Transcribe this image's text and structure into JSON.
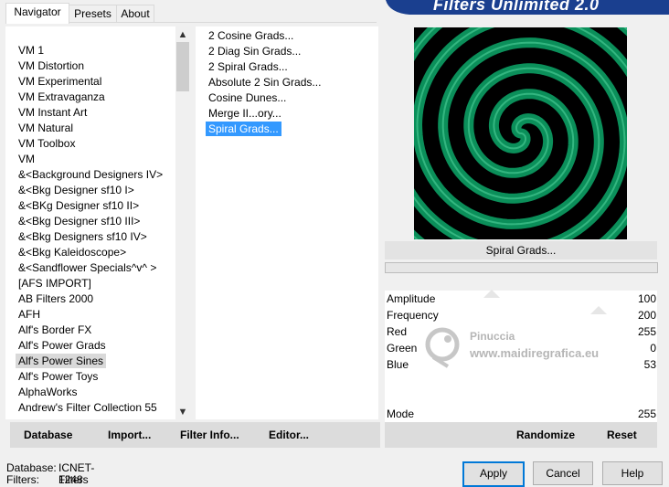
{
  "tabs": [
    {
      "label": "Navigator",
      "active": true
    },
    {
      "label": "Presets",
      "active": false
    },
    {
      "label": "About",
      "active": false
    }
  ],
  "banner": {
    "title": "Filters Unlimited 2.0",
    "color": "#1a3f8f"
  },
  "categories": [
    "VM 1",
    "VM Distortion",
    "VM Experimental",
    "VM Extravaganza",
    "VM Instant Art",
    "VM Natural",
    "VM Toolbox",
    "VM",
    "&<Background Designers IV>",
    "&<Bkg Designer sf10 I>",
    "&<BKg Designer sf10 II>",
    "&<Bkg Designer sf10 III>",
    "&<Bkg Designers sf10 IV>",
    "&<Bkg Kaleidoscope>",
    "&<Sandflower Specials^v^ >",
    "[AFS IMPORT]",
    "AB Filters 2000",
    "AFH",
    "Alf's Border FX",
    "Alf's Power Grads",
    "Alf's Power Sines",
    "Alf's Power Toys",
    "AlphaWorks",
    "Andrew's Filter Collection 55"
  ],
  "selected_category": "Alf's Power Sines",
  "filters": [
    "2 Cosine Grads...",
    "2 Diag Sin Grads...",
    "2 Spiral Grads...",
    "Absolute 2 Sin Grads...",
    "Cosine Dunes...",
    "Merge II...ory...",
    "Spiral Grads..."
  ],
  "selected_filter": "Spiral Grads...",
  "preview": {
    "colors": {
      "ink": "#000000",
      "rings": "#0b8f5a",
      "highlight": "#4fd19a"
    }
  },
  "filter_title": "Spiral Grads...",
  "progress": 0,
  "params": [
    {
      "label": "Amplitude",
      "value": "100"
    },
    {
      "label": "Frequency",
      "value": "200"
    },
    {
      "label": "Red",
      "value": "255"
    },
    {
      "label": "Green",
      "value": "0"
    },
    {
      "label": "Blue",
      "value": "53"
    },
    {
      "label": "Mode",
      "value": "255"
    }
  ],
  "watermark": {
    "name": "Pinuccia",
    "site": "www.maidiregrafica.eu"
  },
  "left_buttons": [
    {
      "label": "Database",
      "name": "database-button"
    },
    {
      "label": "Import...",
      "name": "import-button"
    },
    {
      "label": "Filter Info...",
      "name": "filter-info-button"
    },
    {
      "label": "Editor...",
      "name": "editor-button"
    }
  ],
  "right_buttons": [
    {
      "label": "Randomize",
      "name": "randomize-button"
    },
    {
      "label": "Reset",
      "name": "reset-button"
    }
  ],
  "status": {
    "database_label": "Database:",
    "database_value": "ICNET-Filters",
    "filters_label": "Filters:",
    "filters_value": "1248"
  },
  "dialog_buttons": {
    "apply": "Apply",
    "cancel": "Cancel",
    "help": "Help"
  },
  "scroll": {
    "up": "▲",
    "down": "▼"
  }
}
